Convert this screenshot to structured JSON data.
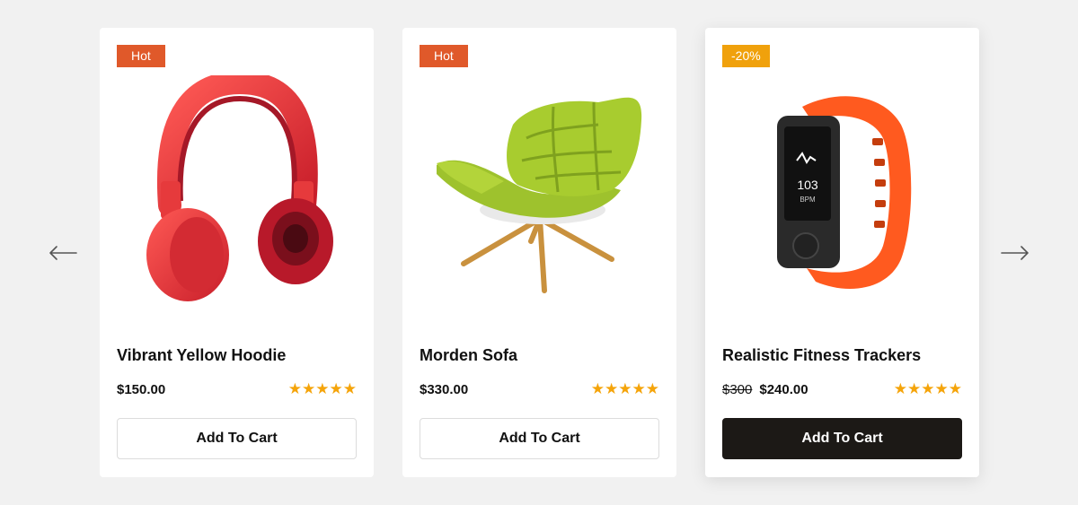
{
  "carousel": {
    "prev_icon": "arrow-left-icon",
    "next_icon": "arrow-right-icon",
    "products": [
      {
        "badge": "Hot",
        "badge_color": "#e0592a",
        "image_icon": "headphones-icon",
        "title": "Vibrant Yellow Hoodie",
        "price": "$150.00",
        "rating": 5,
        "stars": "★★★★★",
        "button_label": "Add To Cart"
      },
      {
        "badge": "Hot",
        "badge_color": "#e0592a",
        "image_icon": "chair-icon",
        "title": "Morden Sofa",
        "price": "$330.00",
        "rating": 5,
        "stars": "★★★★★",
        "button_label": "Add To Cart"
      },
      {
        "badge": "-20%",
        "badge_color": "#f0a10c",
        "image_icon": "fitness-tracker-icon",
        "title": "Realistic Fitness Trackers",
        "old_price": "$300",
        "price": "$240.00",
        "rating": 5,
        "stars": "★★★★★",
        "button_label": "Add To Cart",
        "button_active": true
      }
    ]
  },
  "colors": {
    "background": "#f1f1f1",
    "hot_badge": "#e0592a",
    "sale_badge": "#f0a10c",
    "star": "#f5a40a",
    "dark_button": "#1c1916"
  }
}
